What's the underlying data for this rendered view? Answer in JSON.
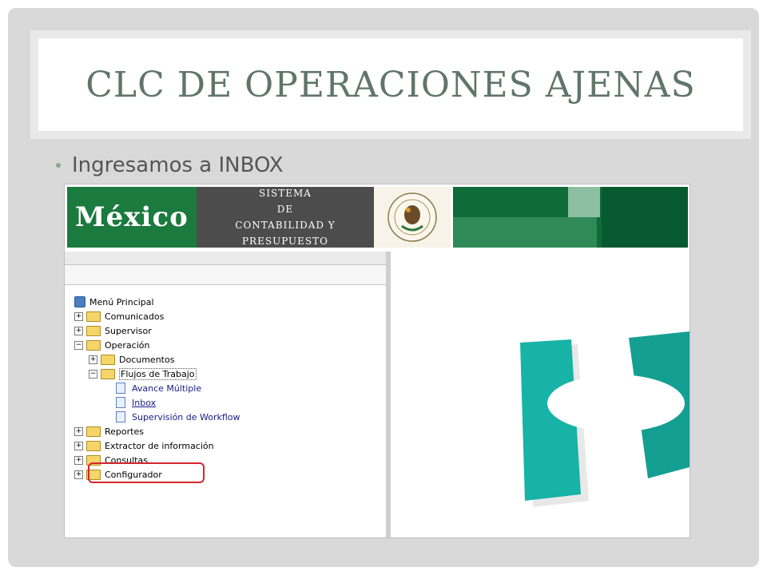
{
  "title": "CLC DE OPERACIONES AJENAS",
  "bullet": "Ingresamos a INBOX",
  "banner": {
    "country": "México",
    "system_lines": [
      "SISTEMA",
      "DE",
      "CONTABILIDAD Y PRESUPUESTO"
    ]
  },
  "tree": {
    "root": "Menú Principal",
    "items": [
      {
        "label": "Comunicados"
      },
      {
        "label": "Supervisor"
      },
      {
        "label": "Operación"
      },
      {
        "label": "Documentos"
      },
      {
        "label": "Flujos de Trabajo"
      },
      {
        "label": "Avance Múltiple"
      },
      {
        "label": "Inbox"
      },
      {
        "label": "Supervisión de Workflow"
      },
      {
        "label": "Reportes"
      },
      {
        "label": "Extractor de información"
      },
      {
        "label": "Consultas"
      },
      {
        "label": "Configurador"
      }
    ]
  },
  "colors": {
    "title": "#607569",
    "banner_green": "#1b7a3e",
    "highlight": "#d4262b",
    "logo_teal": "#17b3a6"
  }
}
